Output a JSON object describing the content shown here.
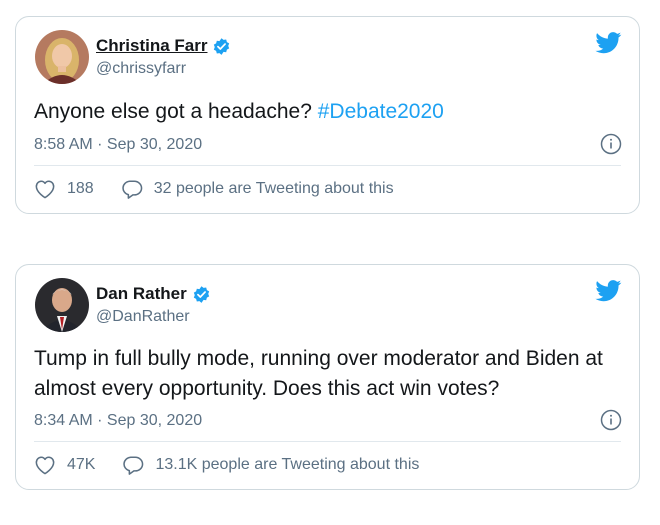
{
  "colors": {
    "accent": "#1da1f2",
    "text": "#14171a",
    "muted": "#5b7083",
    "border": "#cfd9de"
  },
  "tweets": [
    {
      "name": "Christina Farr",
      "handle": "@chrissyfarr",
      "text": "Anyone else got a headache? ",
      "hashtag": "#Debate2020",
      "time": "8:58 AM · Sep 30, 2020",
      "likes": "188",
      "talking": "32 people are Tweeting about this"
    },
    {
      "name": "Dan Rather",
      "handle": "@DanRather",
      "text": "Tump in full bully mode, running over moderator and Biden at almost every opportunity. Does this act win votes?",
      "time": "8:34 AM · Sep 30, 2020",
      "likes": "47K",
      "talking": "13.1K people are Tweeting about this"
    }
  ],
  "icons": {
    "verified": "verified-badge-icon",
    "brand": "twitter-bird-icon",
    "info": "info-icon",
    "like": "heart-icon",
    "reply": "speech-bubble-icon"
  }
}
